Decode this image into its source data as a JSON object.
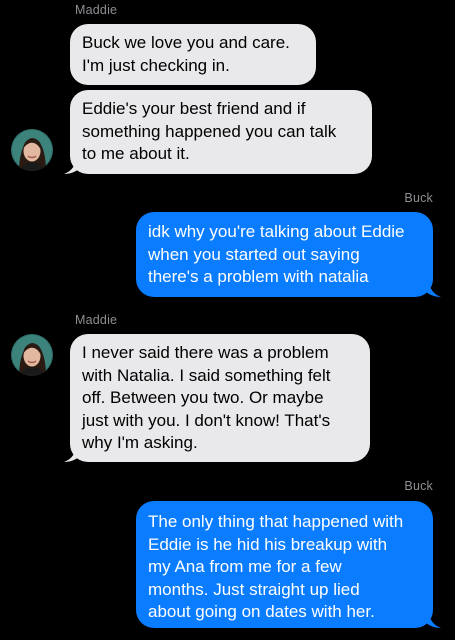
{
  "conversation": {
    "senders": {
      "maddie": "Maddie",
      "buck": "Buck"
    },
    "messages": [
      {
        "from": "Maddie",
        "lines": [
          "Buck we love you and care.",
          "I'm just checking in."
        ]
      },
      {
        "from": "Maddie",
        "lines": [
          "Eddie's your best friend and if",
          "something happened you can talk",
          "to me about it."
        ]
      },
      {
        "from": "Buck",
        "lines": [
          "idk why you're talking about Eddie",
          "when you started out saying",
          "there's a problem with natalia"
        ]
      },
      {
        "from": "Maddie",
        "lines": [
          "I never said there was a problem",
          "with Natalia. I said something felt",
          "off. Between you two. Or maybe",
          "just with you. I don't know! That's",
          "why I'm asking."
        ]
      },
      {
        "from": "Buck",
        "lines": [
          "The only thing that happened with",
          "Eddie is he hid his breakup with",
          "my Ana from me for a few",
          "months. Just straight up lied",
          "about going on dates with her."
        ]
      }
    ]
  },
  "colors": {
    "background": "#000000",
    "incoming_bubble": "#e9e9eb",
    "outgoing_bubble": "#0a7cff",
    "sender_label": "#8e8e93"
  },
  "icons": {
    "avatar": "contact-avatar-icon"
  }
}
